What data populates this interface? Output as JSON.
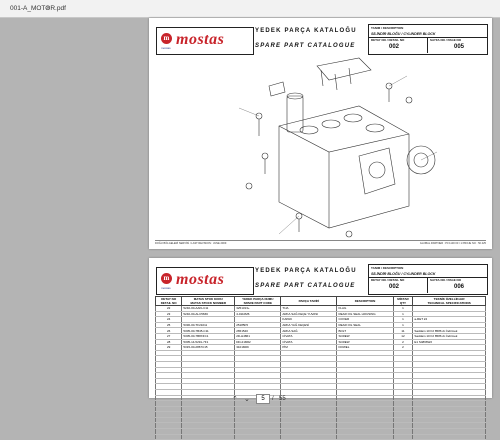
{
  "tab": {
    "title": "001-A_MOTOR.pdf",
    "close": "×"
  },
  "header": {
    "brand": "mostas",
    "logo_letter": "m",
    "logo_sub": "mostas",
    "title_tr": "YEDEK PARÇA KATALOĞU",
    "title_en": "SPARE PART CATALOGUE",
    "desc_label": "TANIM / DESCRIPTION",
    "desc_value": "SİLİNDİR BLOĞU / CYLINDER BLOCK",
    "detail_label": "DETAY NO / DETAIL NO",
    "page_label": "SAYFA NO / PAGE NO"
  },
  "page1": {
    "detail_no": "002",
    "page_no": "005"
  },
  "page2": {
    "detail_no": "002",
    "page_no": "006"
  },
  "footer": {
    "left": "DOĞU BÖLGELERİ SERVİSİ / LAST REVISION : JUNE 2009",
    "right": "GLOBAL PARTNER : P0 1130 00 / 1 PROJE NO : 50 425"
  },
  "table": {
    "headers": [
      "DETAY NO\nDETAIL NO",
      "MATAS STOK KODU\nMATAS STOCK NUMBER",
      "YEDEK PARÇA NUMU\nSPARE PART CODE",
      "PARÇA TARİFİ",
      "DESCRIPTION",
      "MİKTAR\nQTY",
      "TEKNİK ÖZELLİKLER\nTECHNICAL SPECIFICATIONS"
    ],
    "rows": [
      [
        "22",
        "5240-00-AAKLC11",
        "3251313+",
        "TIJA",
        "FLAG",
        "1",
        ""
      ],
      [
        "23",
        "5240-00-ALC5666",
        "4-0110M6",
        "ARKA SAĞ KEÇE YUVASI",
        "REAR OIL SEAL HOUSING",
        "1",
        ""
      ],
      [
        "24",
        "",
        "",
        "KAPAK",
        "COVER",
        "1",
        "a-RET 22"
      ],
      [
        "25",
        "5330-00-TF21011",
        "25185F5",
        "ARKA YAĞ KEÇESİ",
        "REAR OIL SEAL",
        "1",
        ""
      ],
      [
        "26",
        "5305-00-7B45-C11",
        "2651540",
        "ARKA SAĞ",
        "BOLT",
        "11",
        "Saddam 10 F2 8586 Ar.İndirmek"
      ],
      [
        "27",
        "5305-00-7B8XFC1",
        "2D-H4861",
        "CİVATA",
        "SCREW",
        "12",
        "Saddam 10 F2 8586 Ar.İndirmek"
      ],
      [
        "28",
        "5305-14-5291-7F1",
        "DD-21M62",
        "CİVATA",
        "SCREW",
        "2",
        "E1 S4866W2"
      ],
      [
        "29",
        "5315-00-2867C15",
        "3101M09",
        "PİM",
        "DOWEL",
        "2",
        ""
      ]
    ],
    "blank_rows": 16
  },
  "toolbar": {
    "prev": "‹",
    "next": "›",
    "page_current": "5",
    "page_sep": "/",
    "page_total": "55",
    "down_icon": "⌄",
    "up_icon": "⌃"
  }
}
